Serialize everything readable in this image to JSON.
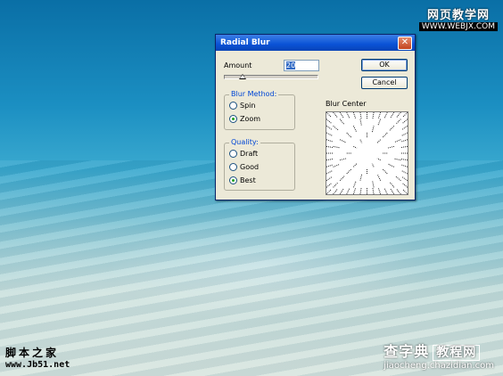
{
  "watermarks": {
    "top_right_line1": "网页教学网",
    "top_right_line2": "WWW.WEBJX.COM",
    "bottom_left_line1": "脚本之家",
    "bottom_left_line2": "www.Jb51.net",
    "bottom_right_line1": "查字典",
    "bottom_right_box": "教程网",
    "bottom_right_line2": "jiaocheng.chazidian.com"
  },
  "dialog": {
    "title": "Radial Blur",
    "close_icon": "close-icon",
    "amount_label": "Amount",
    "amount_value": "20",
    "amount_slider_fraction": 0.2,
    "ok_label": "OK",
    "cancel_label": "Cancel",
    "blur_method": {
      "title": "Blur Method:",
      "options": [
        "Spin",
        "Zoom"
      ],
      "selected": "Zoom"
    },
    "quality": {
      "title": "Quality:",
      "options": [
        "Draft",
        "Good",
        "Best"
      ],
      "selected": "Best"
    },
    "blur_center_label": "Blur Center"
  },
  "colors": {
    "title_bar": "#0a52d6",
    "dialog_bg": "#ece9d8",
    "group_title": "#0046d5"
  }
}
